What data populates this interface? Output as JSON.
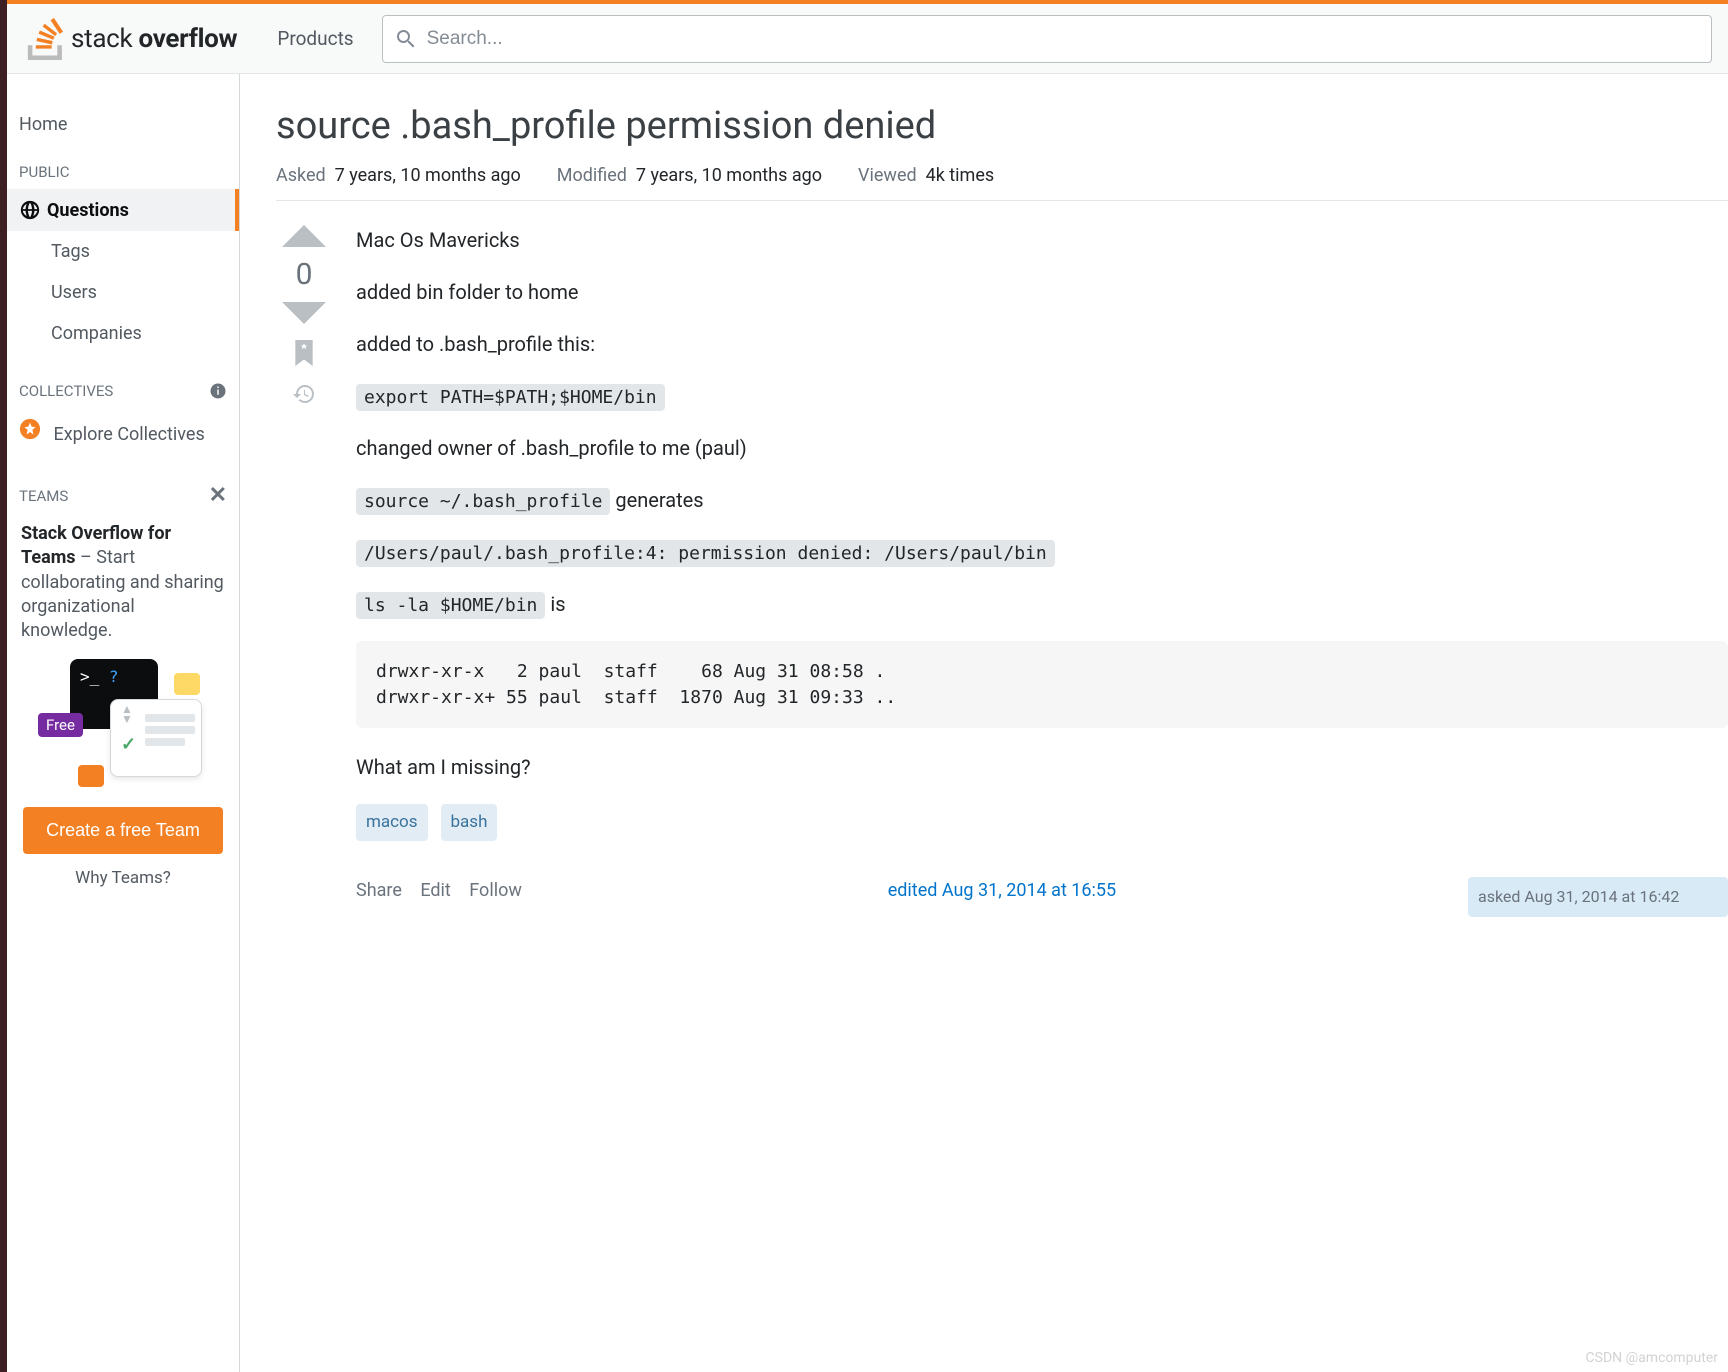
{
  "site": {
    "name_part1": "stack",
    "name_part2": "overflow"
  },
  "topnav": {
    "products": "Products"
  },
  "search": {
    "placeholder": "Search..."
  },
  "sidebar": {
    "home": "Home",
    "public_label": "PUBLIC",
    "items": [
      "Questions",
      "Tags",
      "Users",
      "Companies"
    ],
    "collectives_label": "COLLECTIVES",
    "explore_collectives": "Explore Collectives",
    "teams_label": "TEAMS",
    "teams_promo_bold": "Stack Overflow for Teams",
    "teams_promo_rest": " – Start collaborating and sharing organizational knowledge.",
    "free_badge": "Free",
    "create_team": "Create a free Team",
    "why_teams": "Why Teams?"
  },
  "question": {
    "title": "source .bash_profile permission denied",
    "asked_label": "Asked",
    "asked_value": "7 years, 10 months ago",
    "modified_label": "Modified",
    "modified_value": "7 years, 10 months ago",
    "viewed_label": "Viewed",
    "viewed_value": "4k times",
    "score": "0",
    "body": {
      "p1": "Mac Os Mavericks",
      "p2": "added bin folder to home",
      "p3": "added to .bash_profile this:",
      "code1": "export PATH=$PATH;$HOME/bin",
      "p4": "changed owner of .bash_profile to me (paul)",
      "code2": "source  ~/.bash_profile",
      "p5_after": " generates",
      "code3": "/Users/paul/.bash_profile:4: permission denied: /Users/paul/bin",
      "code4": "ls -la $HOME/bin",
      "p6_after": " is",
      "pre1": "drwxr-xr-x   2 paul  staff    68 Aug 31 08:58 .\ndrwxr-xr-x+ 55 paul  staff  1870 Aug 31 09:33 ..",
      "p7": "What am I missing?"
    },
    "tags": [
      "macos",
      "bash"
    ],
    "actions": {
      "share": "Share",
      "edit": "Edit",
      "follow": "Follow"
    },
    "edited": "edited Aug 31, 2014 at 16:55",
    "asked_card": "asked Aug 31, 2014 at 16:42"
  },
  "watermark": "CSDN @amcomputer"
}
